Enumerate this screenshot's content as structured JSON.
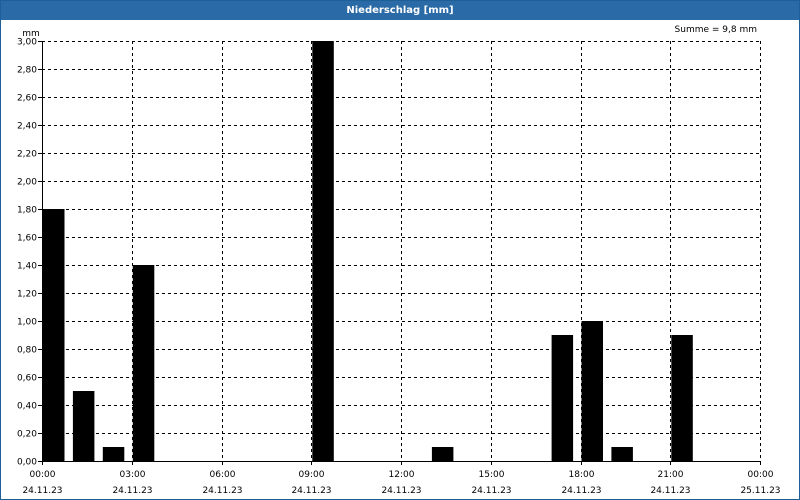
{
  "window": {
    "title": "Niederschlag [mm]"
  },
  "chart_data": {
    "type": "bar",
    "title": "Niederschlag [mm]",
    "ylabel": "mm",
    "annotation": "Summe = 9,8 mm",
    "ylim": [
      0,
      3.0
    ],
    "y_ticks": [
      "0,00",
      "0,20",
      "0,40",
      "0,60",
      "0,80",
      "1,00",
      "1,20",
      "1,40",
      "1,60",
      "1,80",
      "2,00",
      "2,20",
      "2,40",
      "2,60",
      "2,80",
      "3,00"
    ],
    "x_range_hours": [
      0,
      24
    ],
    "x_ticks": [
      {
        "time": "00:00",
        "date": "24.11.23"
      },
      {
        "time": "03:00",
        "date": "24.11.23"
      },
      {
        "time": "06:00",
        "date": "24.11.23"
      },
      {
        "time": "09:00",
        "date": "24.11.23"
      },
      {
        "time": "12:00",
        "date": "24.11.23"
      },
      {
        "time": "15:00",
        "date": "24.11.23"
      },
      {
        "time": "18:00",
        "date": "24.11.23"
      },
      {
        "time": "21:00",
        "date": "24.11.23"
      },
      {
        "time": "00:00",
        "date": "25.11.23"
      }
    ],
    "grid": true,
    "bar_color": "#000000",
    "series": [
      {
        "values": [
          {
            "x": "00:00",
            "y": 1.8
          },
          {
            "x": "01:00",
            "y": 0.5
          },
          {
            "x": "02:00",
            "y": 0.1
          },
          {
            "x": "03:00",
            "y": 1.4
          },
          {
            "x": "09:00",
            "y": 3.0
          },
          {
            "x": "13:00",
            "y": 0.1
          },
          {
            "x": "17:00",
            "y": 0.9
          },
          {
            "x": "18:00",
            "y": 1.0
          },
          {
            "x": "19:00",
            "y": 0.1
          },
          {
            "x": "21:00",
            "y": 0.9
          }
        ]
      }
    ]
  }
}
